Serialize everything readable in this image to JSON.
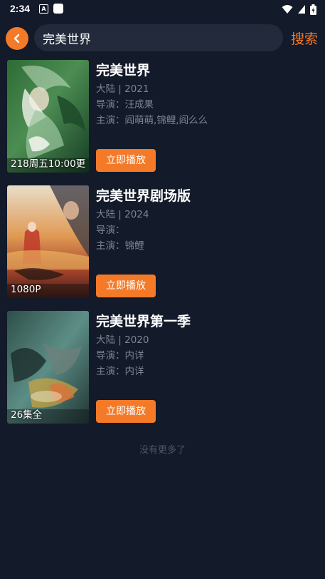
{
  "status_bar": {
    "time": "2:34",
    "app_icon_letter": "A"
  },
  "search": {
    "query": "完美世界",
    "button_label": "搜索"
  },
  "results": [
    {
      "title": "完美世界",
      "region_year": "大陆 | 2021",
      "director": "导演：汪成果",
      "cast": "主演：阎萌萌,锦鲤,阎么么",
      "badge": "218周五10:00更",
      "play_label": "立即播放"
    },
    {
      "title": "完美世界剧场版",
      "region_year": "大陆 | 2024",
      "director": "导演：",
      "cast": "主演：锦鲤",
      "badge": "1080P",
      "play_label": "立即播放"
    },
    {
      "title": "完美世界第一季",
      "region_year": "大陆 | 2020",
      "director": "导演：内详",
      "cast": "主演：内详",
      "badge": "26集全",
      "play_label": "立即播放"
    }
  ],
  "footer": {
    "no_more_text": "没有更多了"
  },
  "colors": {
    "background": "#131a2a",
    "accent": "#f47a28",
    "search_bg": "#222a3b",
    "meta_text": "#7d8494"
  }
}
